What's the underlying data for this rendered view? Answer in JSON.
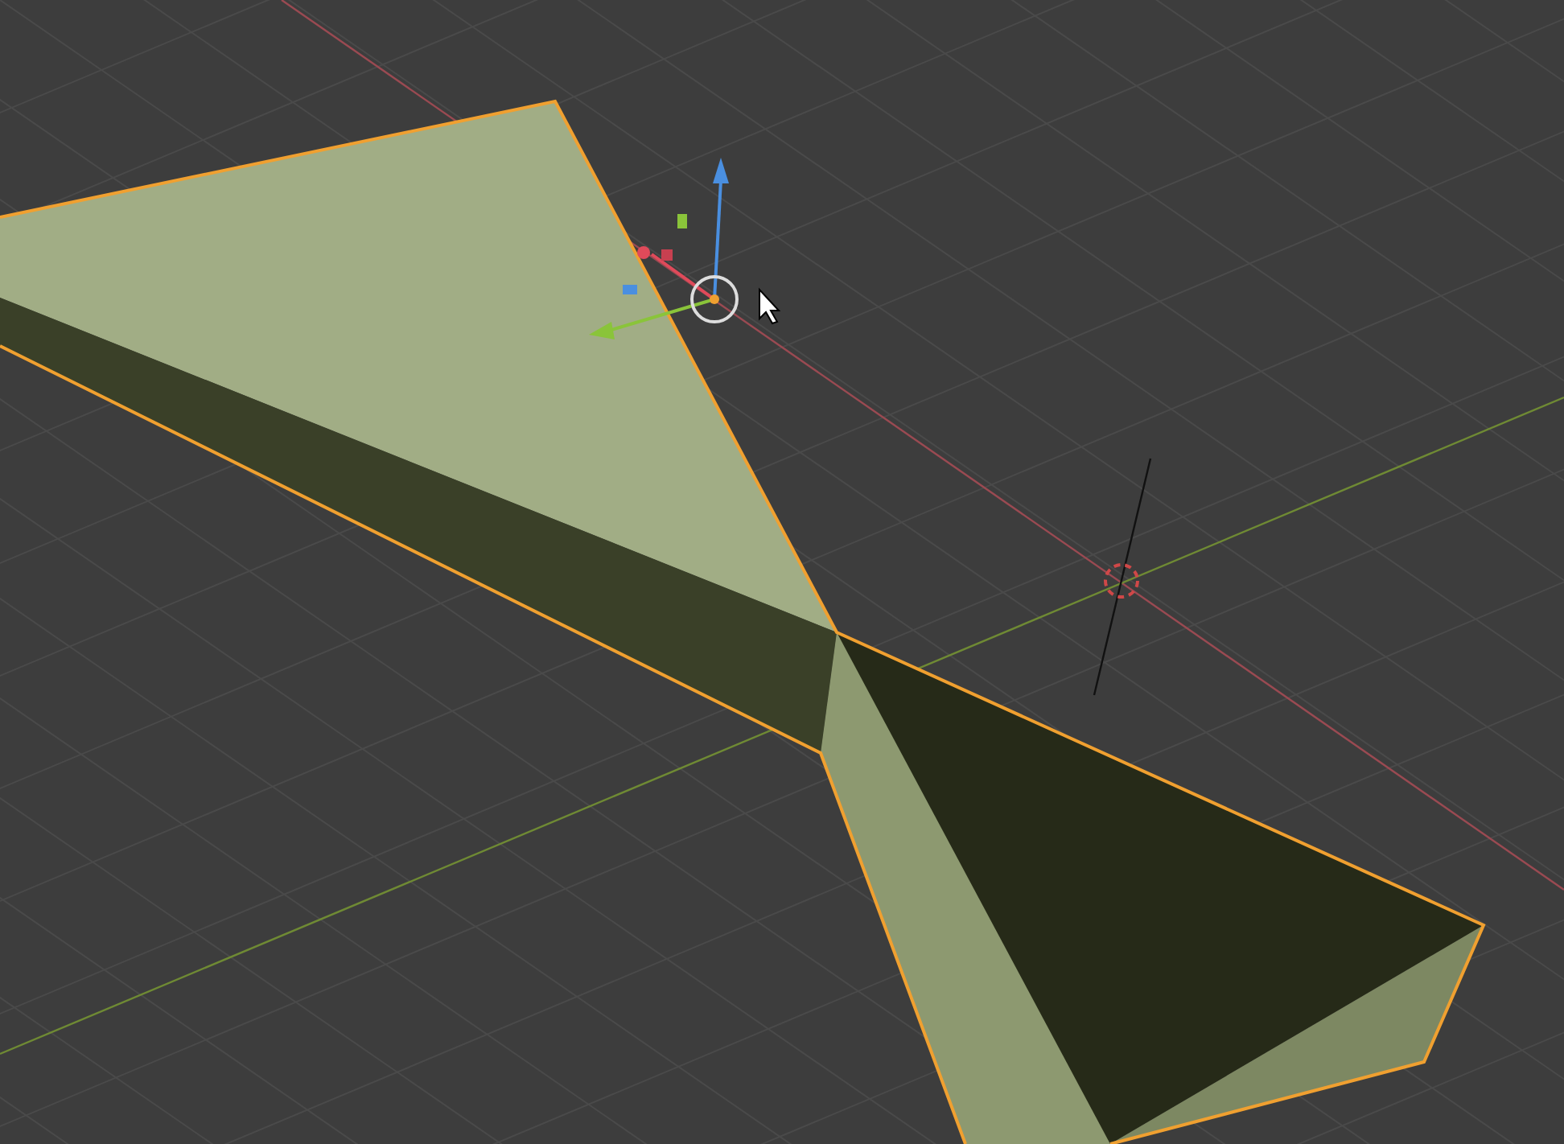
{
  "scene": {
    "objects": [
      {
        "kind": "mesh",
        "selected": true
      }
    ]
  }
}
